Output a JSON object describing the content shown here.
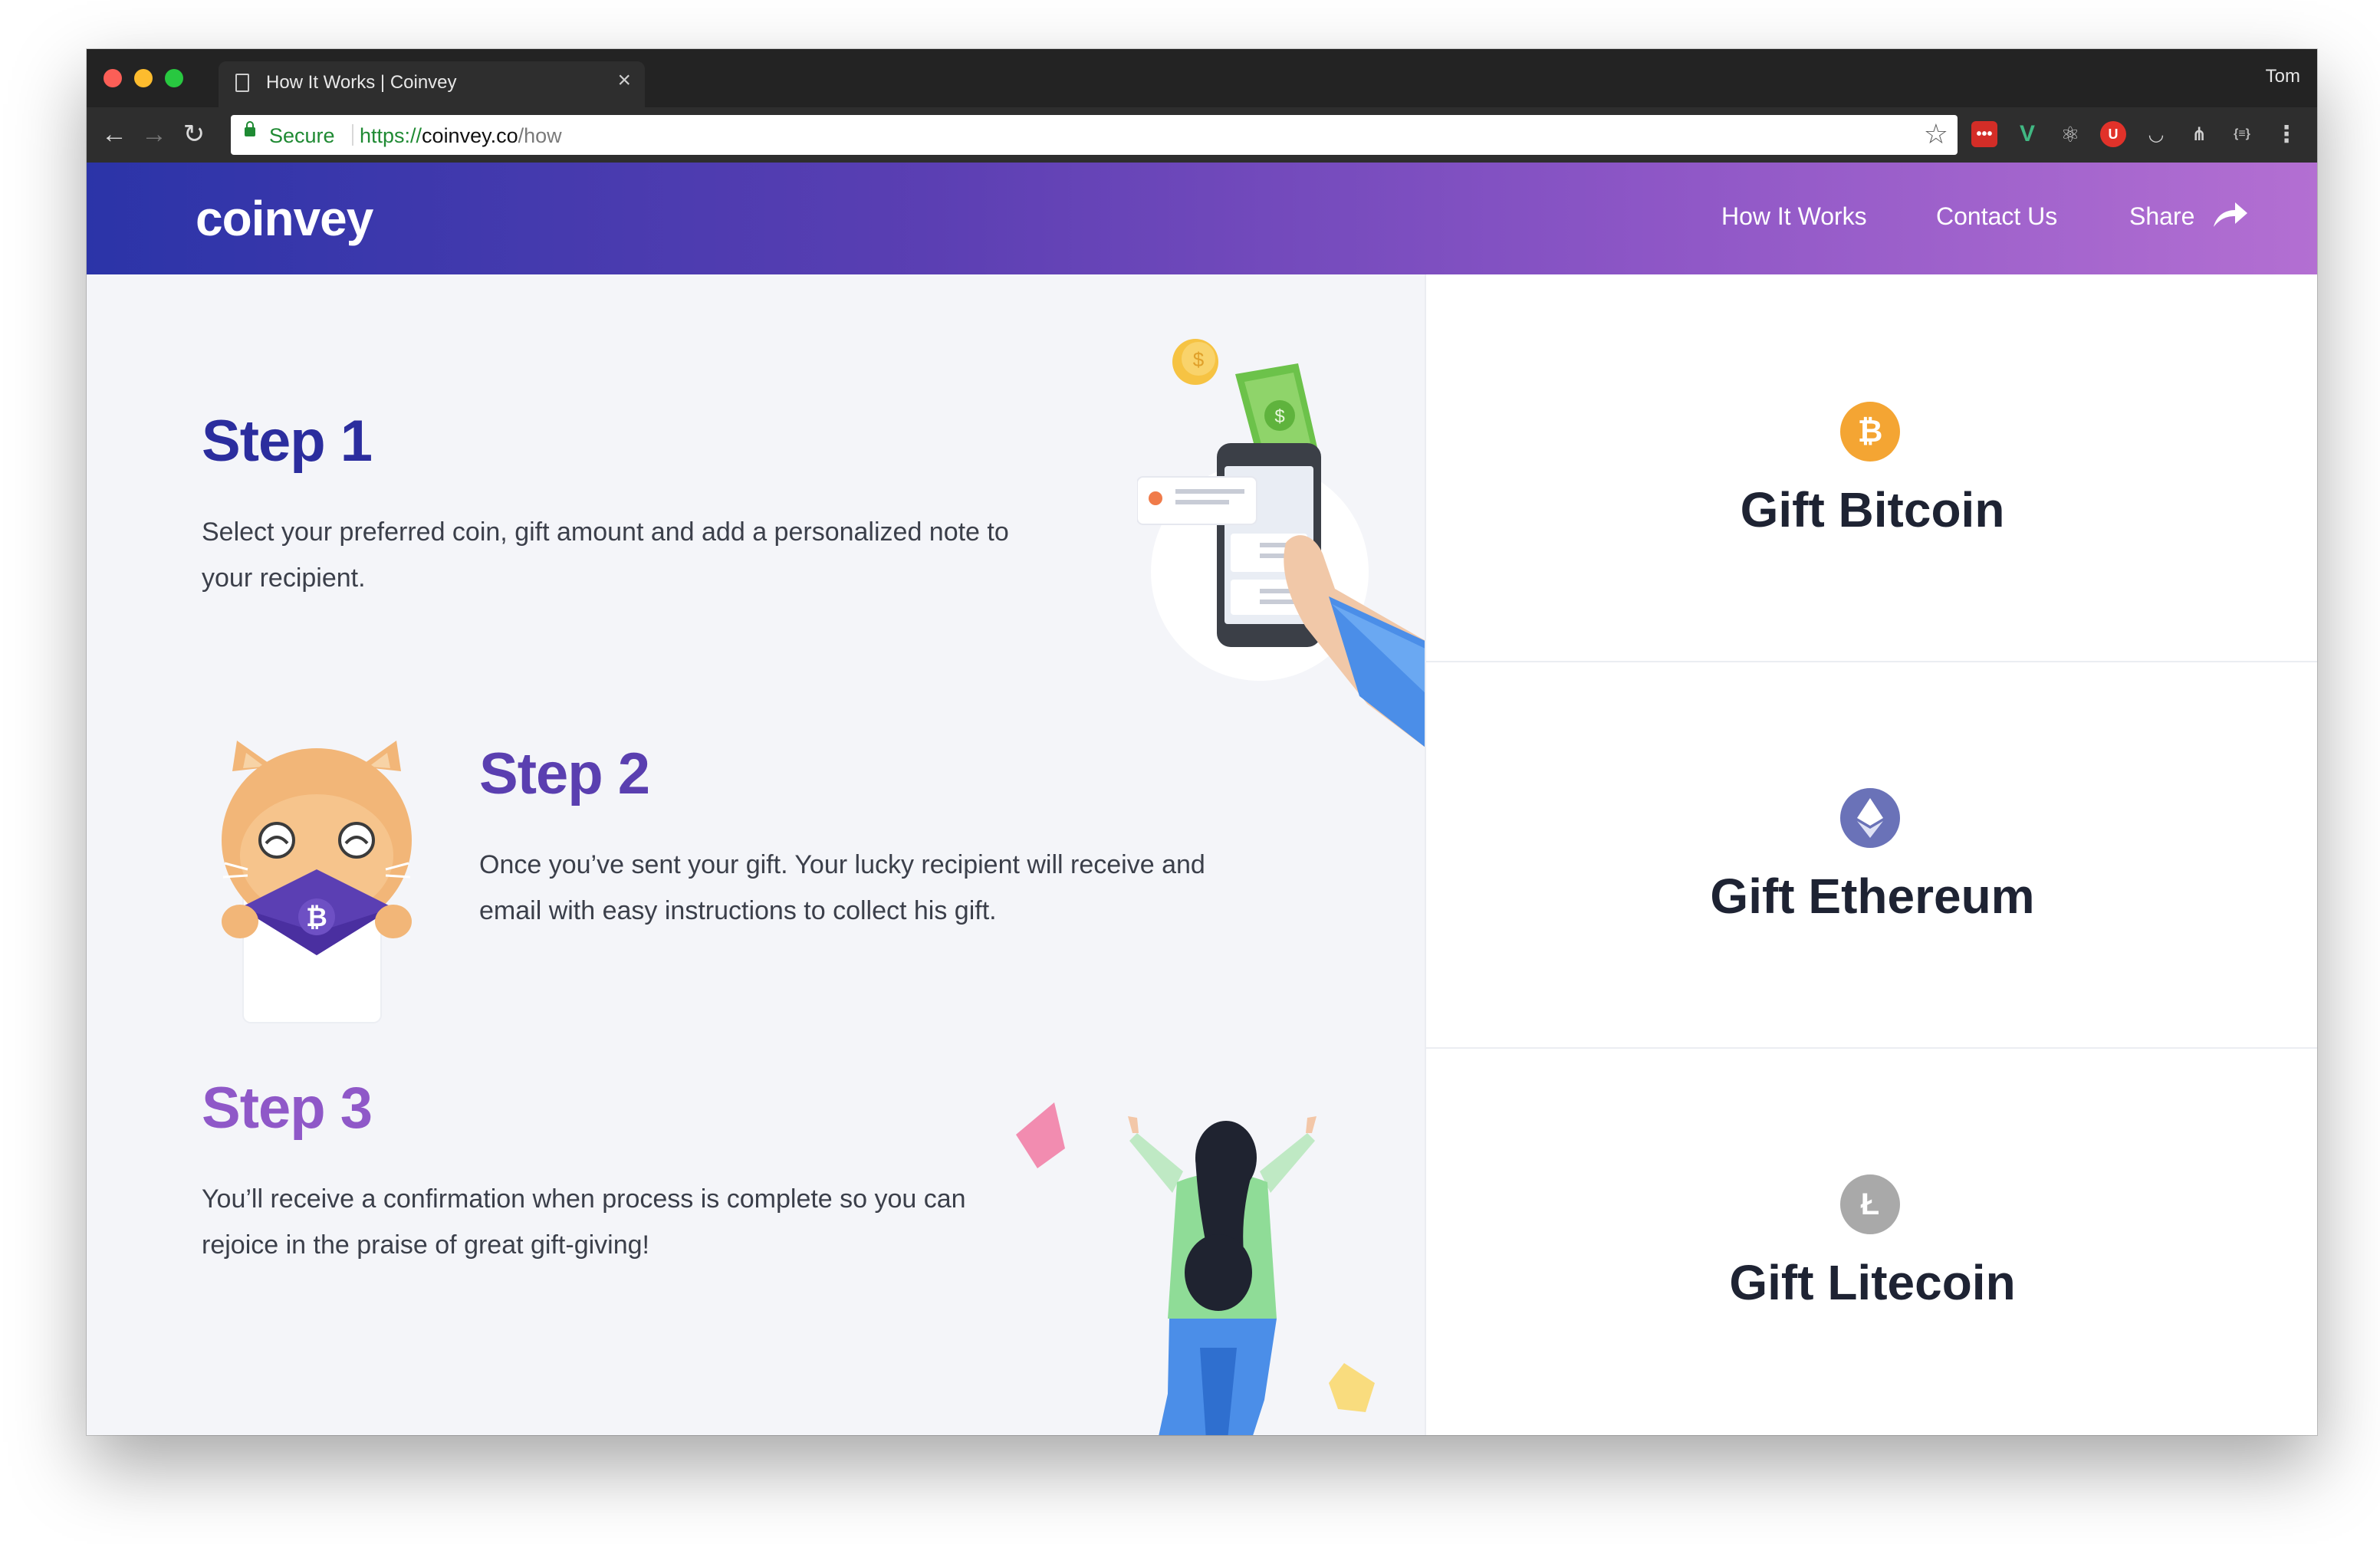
{
  "browser": {
    "tab_title": "How It Works | Coinvey",
    "profile": "Tom",
    "secure_label": "Secure",
    "url_scheme": "https://",
    "url_host": "coinvey.co",
    "url_path": "/how"
  },
  "site": {
    "logo": "coinvey",
    "nav": {
      "how_it_works": "How It Works",
      "contact": "Contact Us",
      "share": "Share"
    }
  },
  "steps": [
    {
      "title": "Step 1",
      "text": "Select your preferred coin, gift amount and add a personalized note to your recipient.",
      "color": "#2b2d9e"
    },
    {
      "title": "Step 2",
      "text": "Once you’ve sent your gift. Your lucky recipient will receive and email with easy instructions to collect his gift.",
      "color": "#5a3fb0"
    },
    {
      "title": "Step 3",
      "text": "You’ll receive a confirmation when process is complete so you can rejoice in the praise of great gift-giving!",
      "color": "#8f58c8"
    }
  ],
  "gift_cards": [
    {
      "label": "Gift Bitcoin",
      "icon": "bitcoin-icon",
      "color": "#f4a533"
    },
    {
      "label": "Gift Ethereum",
      "icon": "ethereum-icon",
      "color": "#6a72b8"
    },
    {
      "label": "Gift Litecoin",
      "icon": "litecoin-icon",
      "color": "#a9a9a9"
    }
  ],
  "colors": {
    "header_gradient_start": "#2b34a8",
    "header_gradient_end": "#b36fd2",
    "page_bg": "#f4f5f9"
  }
}
